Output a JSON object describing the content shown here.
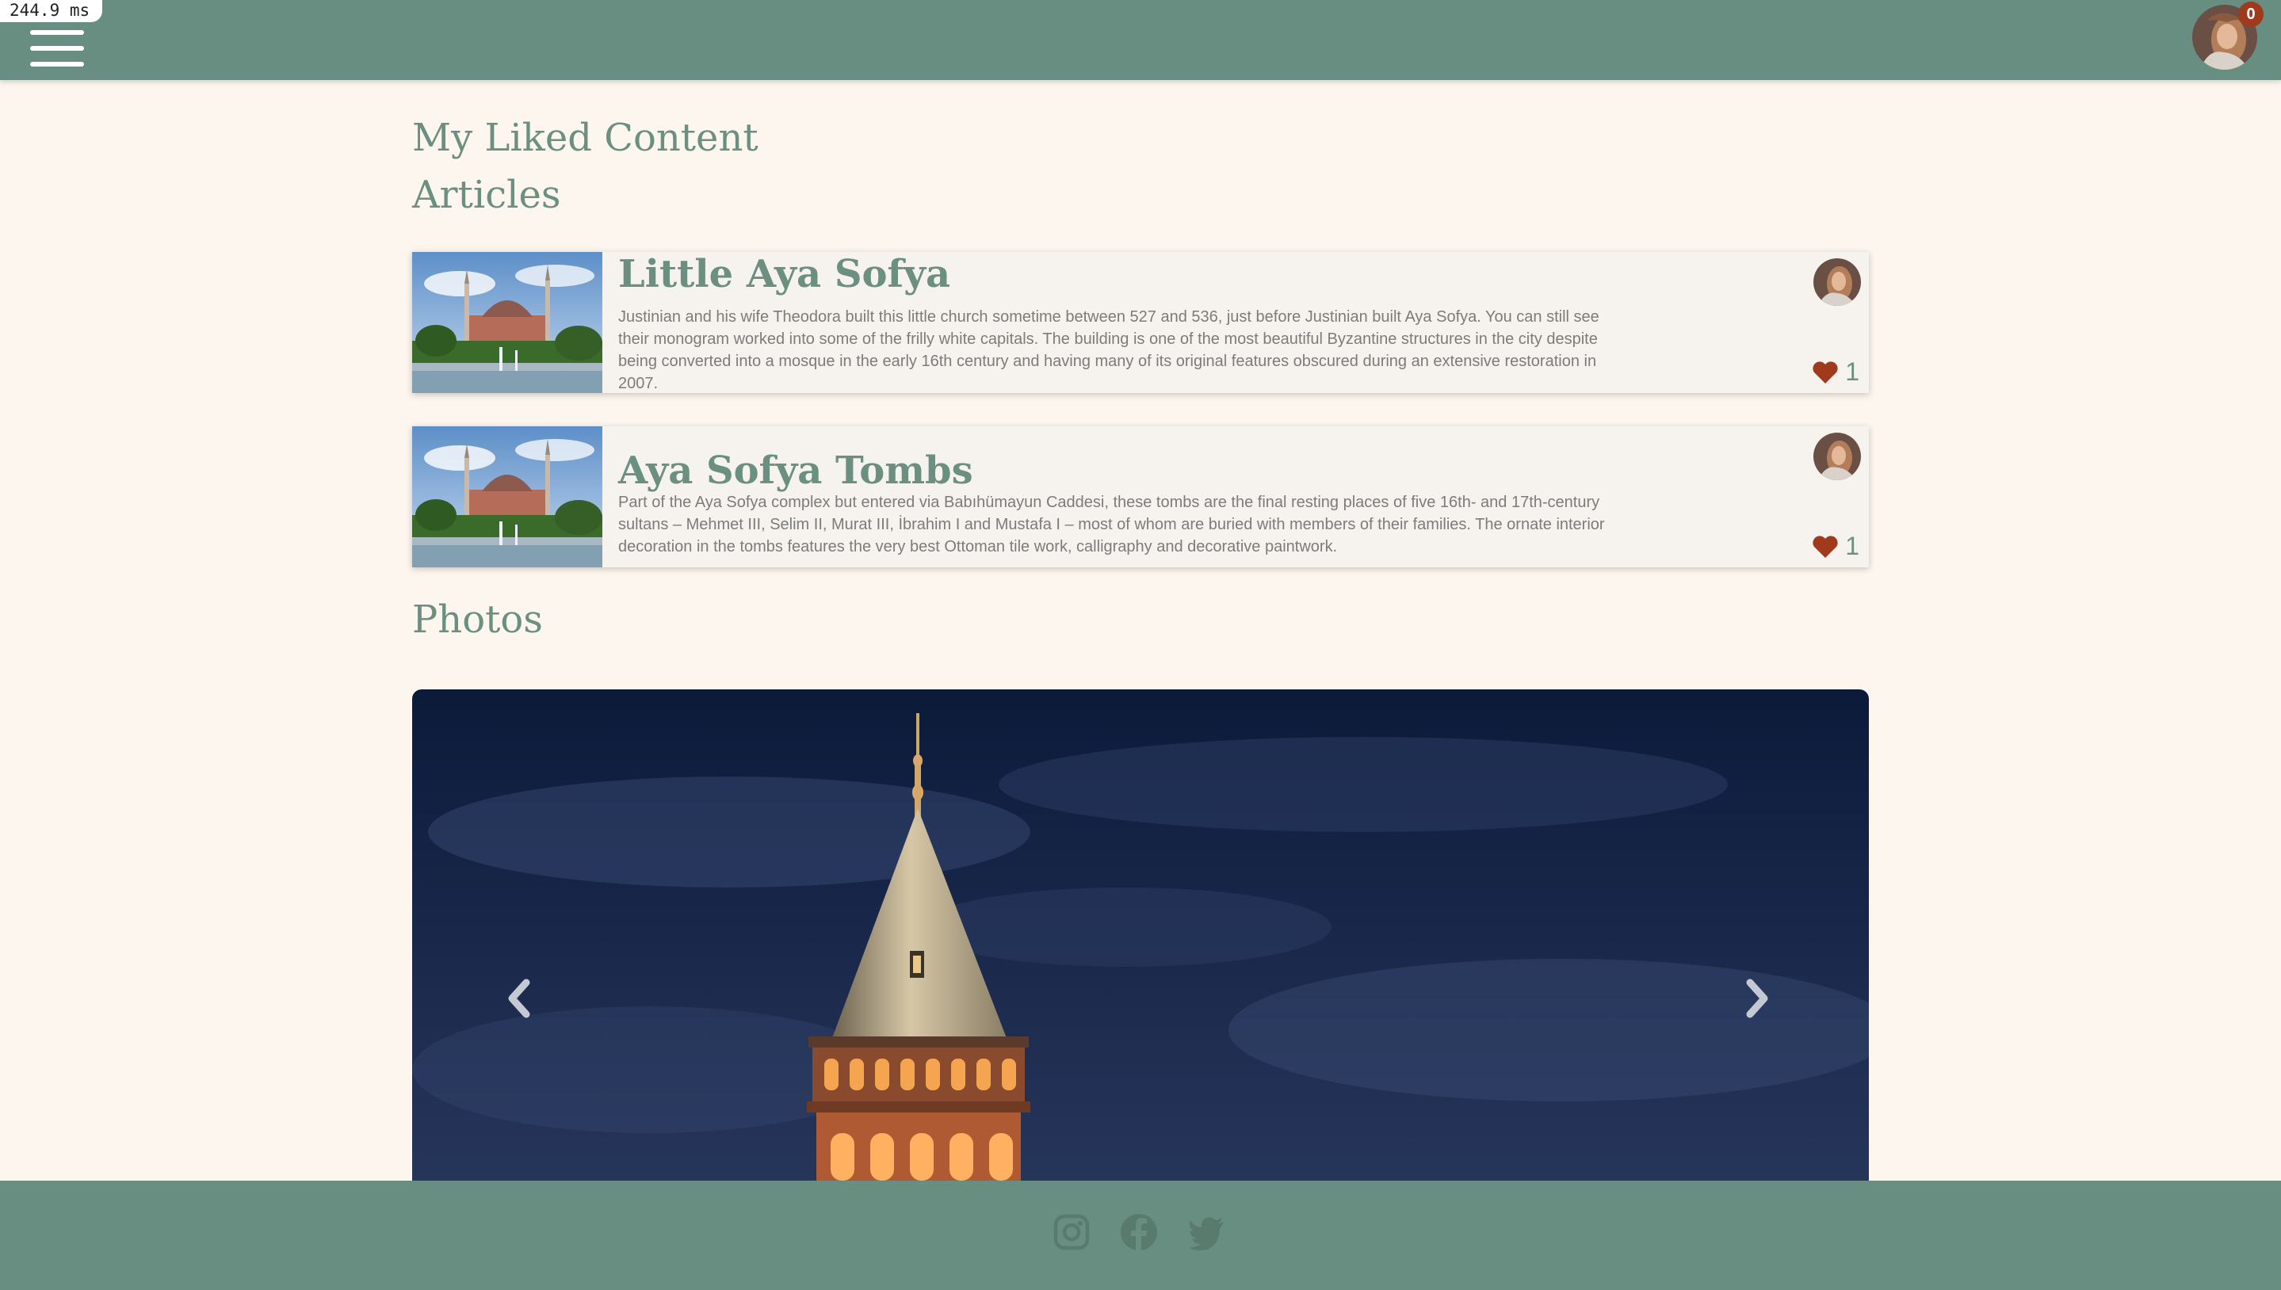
{
  "timer": "244.9 ms",
  "header": {
    "notification_count": "0"
  },
  "page": {
    "title": "My Liked Content",
    "articles_heading": "Articles",
    "photos_heading": "Photos"
  },
  "articles": [
    {
      "title": "Little Aya Sofya",
      "text": "Justinian and his wife Theodora built this little church sometime between 527 and 536, just before Justinian built Aya Sofya. You can still see their monogram worked into some of the frilly white capitals. The building is one of the most beautiful Byzantine structures in the city despite being converted into a mosque in the early 16th century and having many of its original features obscured during an extensive restoration in 2007.",
      "likes": "1"
    },
    {
      "title": "Aya Sofya Tombs",
      "text": "Part of the Aya Sofya complex but entered via Babıhümayun Caddesi, these tombs are the final resting places of five 16th- and 17th-century sultans – Mehmet III, Selim II, Murat III, İbrahim I and Mustafa I – most of whom are buried with members of their families. The ornate interior decoration in the tombs features the very best Ottoman tile work, calligraphy and decorative paintwork.",
      "likes": "1"
    }
  ],
  "colors": {
    "header_bg": "#678e81",
    "page_bg": "#fdf6ee",
    "accent_text": "#6b8f80",
    "heart": "#a03a1c"
  },
  "icons": {
    "menu": "hamburger-icon",
    "heart": "heart-icon",
    "prev": "chevron-left-icon",
    "next": "chevron-right-icon",
    "social": [
      "instagram-icon",
      "facebook-icon",
      "twitter-icon"
    ]
  }
}
